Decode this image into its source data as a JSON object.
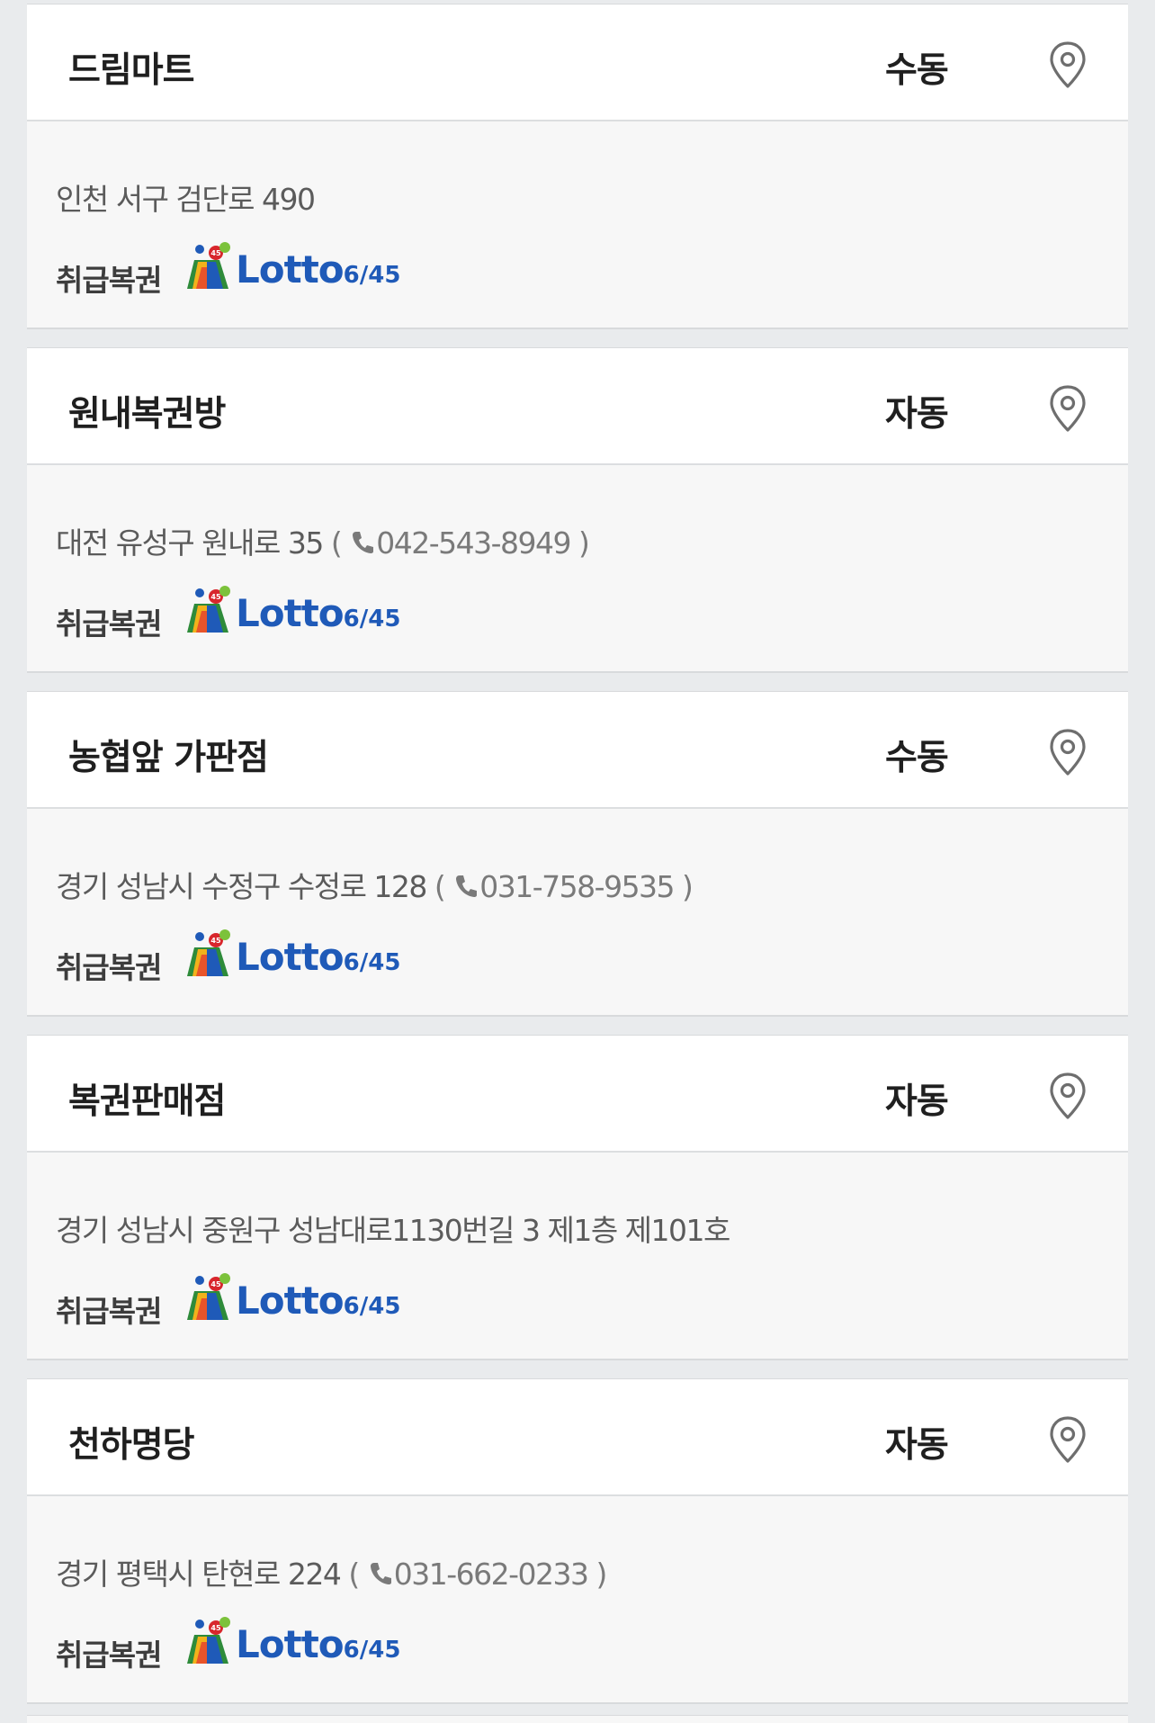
{
  "goods_label": "취급복권",
  "lotto_logo": {
    "word": "Lotto",
    "number": "6/45",
    "ball_text": "45"
  },
  "stores": [
    {
      "name": "드림마트",
      "type": "수동",
      "address": "인천 서구 검단로 490",
      "phone": ""
    },
    {
      "name": "원내복권방",
      "type": "자동",
      "address": "대전 유성구 원내로 35",
      "phone": "042-543-8949"
    },
    {
      "name": "농협앞 가판점",
      "type": "수동",
      "address": "경기 성남시 수정구 수정로 128",
      "phone": "031-758-9535"
    },
    {
      "name": "복권판매점",
      "type": "자동",
      "address": "경기 성남시 중원구 성남대로1130번길 3 제1층 제101호",
      "phone": ""
    },
    {
      "name": "천하명당",
      "type": "자동",
      "address": "경기 평택시 탄현로 224",
      "phone": "031-662-0233"
    }
  ],
  "icons": {
    "location": "map-pin-icon",
    "phone": "phone-icon"
  },
  "colors": {
    "lotto_blue": "#1f5ab8",
    "lotto_green": "#7cc23b",
    "background": "#e9ebed"
  }
}
